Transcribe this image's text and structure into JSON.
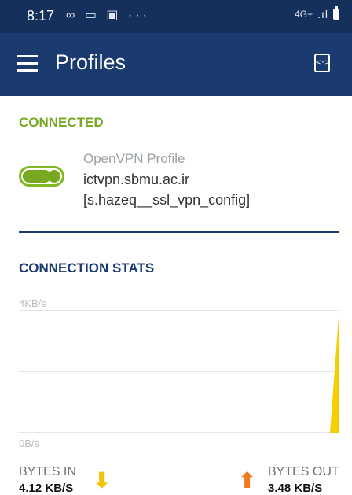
{
  "status_bar": {
    "time": "8:17",
    "left_icons": "∞ ▭ ▣ ···",
    "network": "4G+",
    "signal": ".ıl"
  },
  "app_bar": {
    "title": "Profiles",
    "menu_icon": "menu-icon",
    "import_icon": "import-profile-icon",
    "import_glyph": "<·>"
  },
  "connection": {
    "status": "CONNECTED",
    "toggle_on": true,
    "profile_type": "OpenVPN Profile",
    "host": "ictvpn.sbmu.ac.ir",
    "config": "[s.hazeq__ssl_vpn_config]"
  },
  "stats": {
    "title": "CONNECTION STATS",
    "y_max_label": "4KB/s",
    "y_min_label": "0B/s",
    "bytes_in_label": "BYTES IN",
    "bytes_in_value": "4.12 KB/S",
    "bytes_out_label": "BYTES OUT",
    "bytes_out_value": "3.48 KB/S"
  },
  "chart_data": {
    "type": "area",
    "title": "",
    "xlabel": "",
    "ylabel": "",
    "ylim": [
      0,
      4
    ],
    "ytick_labels": [
      "0B/s",
      "4KB/s"
    ],
    "series": [
      {
        "values": [
          0,
          0,
          0,
          0,
          0,
          0,
          0,
          0,
          0,
          0,
          0,
          0,
          0,
          0,
          0,
          0,
          0,
          0,
          0,
          0,
          0,
          0,
          0,
          0,
          0,
          0,
          0,
          4.12
        ]
      }
    ],
    "colors": {
      "area": "#f5cf00",
      "grid": "#c8cbcf"
    }
  }
}
